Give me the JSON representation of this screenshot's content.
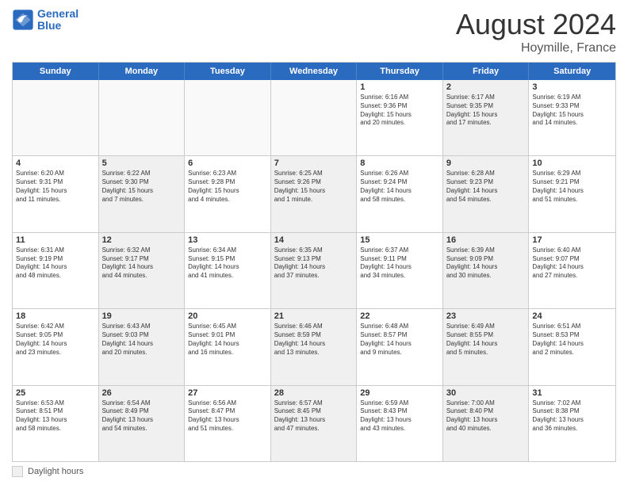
{
  "logo": {
    "line1": "General",
    "line2": "Blue"
  },
  "header": {
    "month": "August 2024",
    "location": "Hoymille, France"
  },
  "weekdays": [
    "Sunday",
    "Monday",
    "Tuesday",
    "Wednesday",
    "Thursday",
    "Friday",
    "Saturday"
  ],
  "footer": {
    "label": "Daylight hours"
  },
  "rows": [
    [
      {
        "day": "",
        "empty": true,
        "lines": []
      },
      {
        "day": "",
        "empty": true,
        "lines": []
      },
      {
        "day": "",
        "empty": true,
        "lines": []
      },
      {
        "day": "",
        "empty": true,
        "lines": []
      },
      {
        "day": "1",
        "empty": false,
        "shaded": false,
        "lines": [
          "Sunrise: 6:16 AM",
          "Sunset: 9:36 PM",
          "Daylight: 15 hours",
          "and 20 minutes."
        ]
      },
      {
        "day": "2",
        "empty": false,
        "shaded": true,
        "lines": [
          "Sunrise: 6:17 AM",
          "Sunset: 9:35 PM",
          "Daylight: 15 hours",
          "and 17 minutes."
        ]
      },
      {
        "day": "3",
        "empty": false,
        "shaded": false,
        "lines": [
          "Sunrise: 6:19 AM",
          "Sunset: 9:33 PM",
          "Daylight: 15 hours",
          "and 14 minutes."
        ]
      }
    ],
    [
      {
        "day": "4",
        "empty": false,
        "shaded": false,
        "lines": [
          "Sunrise: 6:20 AM",
          "Sunset: 9:31 PM",
          "Daylight: 15 hours",
          "and 11 minutes."
        ]
      },
      {
        "day": "5",
        "empty": false,
        "shaded": true,
        "lines": [
          "Sunrise: 6:22 AM",
          "Sunset: 9:30 PM",
          "Daylight: 15 hours",
          "and 7 minutes."
        ]
      },
      {
        "day": "6",
        "empty": false,
        "shaded": false,
        "lines": [
          "Sunrise: 6:23 AM",
          "Sunset: 9:28 PM",
          "Daylight: 15 hours",
          "and 4 minutes."
        ]
      },
      {
        "day": "7",
        "empty": false,
        "shaded": true,
        "lines": [
          "Sunrise: 6:25 AM",
          "Sunset: 9:26 PM",
          "Daylight: 15 hours",
          "and 1 minute."
        ]
      },
      {
        "day": "8",
        "empty": false,
        "shaded": false,
        "lines": [
          "Sunrise: 6:26 AM",
          "Sunset: 9:24 PM",
          "Daylight: 14 hours",
          "and 58 minutes."
        ]
      },
      {
        "day": "9",
        "empty": false,
        "shaded": true,
        "lines": [
          "Sunrise: 6:28 AM",
          "Sunset: 9:23 PM",
          "Daylight: 14 hours",
          "and 54 minutes."
        ]
      },
      {
        "day": "10",
        "empty": false,
        "shaded": false,
        "lines": [
          "Sunrise: 6:29 AM",
          "Sunset: 9:21 PM",
          "Daylight: 14 hours",
          "and 51 minutes."
        ]
      }
    ],
    [
      {
        "day": "11",
        "empty": false,
        "shaded": false,
        "lines": [
          "Sunrise: 6:31 AM",
          "Sunset: 9:19 PM",
          "Daylight: 14 hours",
          "and 48 minutes."
        ]
      },
      {
        "day": "12",
        "empty": false,
        "shaded": true,
        "lines": [
          "Sunrise: 6:32 AM",
          "Sunset: 9:17 PM",
          "Daylight: 14 hours",
          "and 44 minutes."
        ]
      },
      {
        "day": "13",
        "empty": false,
        "shaded": false,
        "lines": [
          "Sunrise: 6:34 AM",
          "Sunset: 9:15 PM",
          "Daylight: 14 hours",
          "and 41 minutes."
        ]
      },
      {
        "day": "14",
        "empty": false,
        "shaded": true,
        "lines": [
          "Sunrise: 6:35 AM",
          "Sunset: 9:13 PM",
          "Daylight: 14 hours",
          "and 37 minutes."
        ]
      },
      {
        "day": "15",
        "empty": false,
        "shaded": false,
        "lines": [
          "Sunrise: 6:37 AM",
          "Sunset: 9:11 PM",
          "Daylight: 14 hours",
          "and 34 minutes."
        ]
      },
      {
        "day": "16",
        "empty": false,
        "shaded": true,
        "lines": [
          "Sunrise: 6:39 AM",
          "Sunset: 9:09 PM",
          "Daylight: 14 hours",
          "and 30 minutes."
        ]
      },
      {
        "day": "17",
        "empty": false,
        "shaded": false,
        "lines": [
          "Sunrise: 6:40 AM",
          "Sunset: 9:07 PM",
          "Daylight: 14 hours",
          "and 27 minutes."
        ]
      }
    ],
    [
      {
        "day": "18",
        "empty": false,
        "shaded": false,
        "lines": [
          "Sunrise: 6:42 AM",
          "Sunset: 9:05 PM",
          "Daylight: 14 hours",
          "and 23 minutes."
        ]
      },
      {
        "day": "19",
        "empty": false,
        "shaded": true,
        "lines": [
          "Sunrise: 6:43 AM",
          "Sunset: 9:03 PM",
          "Daylight: 14 hours",
          "and 20 minutes."
        ]
      },
      {
        "day": "20",
        "empty": false,
        "shaded": false,
        "lines": [
          "Sunrise: 6:45 AM",
          "Sunset: 9:01 PM",
          "Daylight: 14 hours",
          "and 16 minutes."
        ]
      },
      {
        "day": "21",
        "empty": false,
        "shaded": true,
        "lines": [
          "Sunrise: 6:46 AM",
          "Sunset: 8:59 PM",
          "Daylight: 14 hours",
          "and 13 minutes."
        ]
      },
      {
        "day": "22",
        "empty": false,
        "shaded": false,
        "lines": [
          "Sunrise: 6:48 AM",
          "Sunset: 8:57 PM",
          "Daylight: 14 hours",
          "and 9 minutes."
        ]
      },
      {
        "day": "23",
        "empty": false,
        "shaded": true,
        "lines": [
          "Sunrise: 6:49 AM",
          "Sunset: 8:55 PM",
          "Daylight: 14 hours",
          "and 5 minutes."
        ]
      },
      {
        "day": "24",
        "empty": false,
        "shaded": false,
        "lines": [
          "Sunrise: 6:51 AM",
          "Sunset: 8:53 PM",
          "Daylight: 14 hours",
          "and 2 minutes."
        ]
      }
    ],
    [
      {
        "day": "25",
        "empty": false,
        "shaded": false,
        "lines": [
          "Sunrise: 6:53 AM",
          "Sunset: 8:51 PM",
          "Daylight: 13 hours",
          "and 58 minutes."
        ]
      },
      {
        "day": "26",
        "empty": false,
        "shaded": true,
        "lines": [
          "Sunrise: 6:54 AM",
          "Sunset: 8:49 PM",
          "Daylight: 13 hours",
          "and 54 minutes."
        ]
      },
      {
        "day": "27",
        "empty": false,
        "shaded": false,
        "lines": [
          "Sunrise: 6:56 AM",
          "Sunset: 8:47 PM",
          "Daylight: 13 hours",
          "and 51 minutes."
        ]
      },
      {
        "day": "28",
        "empty": false,
        "shaded": true,
        "lines": [
          "Sunrise: 6:57 AM",
          "Sunset: 8:45 PM",
          "Daylight: 13 hours",
          "and 47 minutes."
        ]
      },
      {
        "day": "29",
        "empty": false,
        "shaded": false,
        "lines": [
          "Sunrise: 6:59 AM",
          "Sunset: 8:43 PM",
          "Daylight: 13 hours",
          "and 43 minutes."
        ]
      },
      {
        "day": "30",
        "empty": false,
        "shaded": true,
        "lines": [
          "Sunrise: 7:00 AM",
          "Sunset: 8:40 PM",
          "Daylight: 13 hours",
          "and 40 minutes."
        ]
      },
      {
        "day": "31",
        "empty": false,
        "shaded": false,
        "lines": [
          "Sunrise: 7:02 AM",
          "Sunset: 8:38 PM",
          "Daylight: 13 hours",
          "and 36 minutes."
        ]
      }
    ]
  ]
}
